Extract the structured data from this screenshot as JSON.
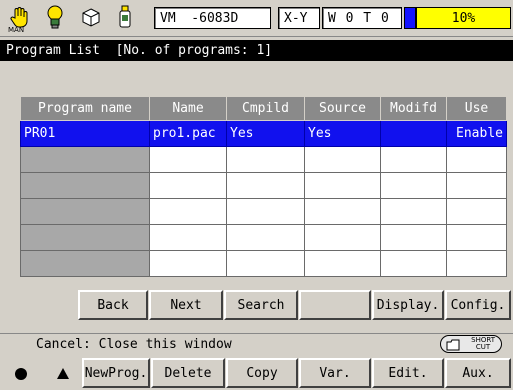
{
  "status": {
    "man_label": "MAN",
    "machine_field": "VM  -6083D",
    "axis_label": "X-Y",
    "coord_value": "W 0 T 0",
    "progress_text": "10%",
    "progress_fill": 0.1,
    "icons": [
      "hand-icon",
      "lightbulb-icon",
      "cube-icon",
      "bottle-icon"
    ],
    "colors": {
      "progress_fill": "#1414ff",
      "progress_bg": "#ffff00"
    }
  },
  "title": "Program List  [No. of programs: 1]",
  "table": {
    "columns": [
      "Program name",
      "Name",
      "Cmpild",
      "Source",
      "Modifd",
      "Use"
    ],
    "rows": [
      [
        "PR01",
        "pro1.pac",
        "Yes",
        "Yes",
        "",
        "Enable"
      ],
      [
        "",
        "",
        "",
        "",
        "",
        ""
      ],
      [
        "",
        "",
        "",
        "",
        "",
        ""
      ],
      [
        "",
        "",
        "",
        "",
        "",
        ""
      ],
      [
        "",
        "",
        "",
        "",
        "",
        ""
      ],
      [
        "",
        "",
        "",
        "",
        "",
        ""
      ]
    ],
    "selected_row": 0
  },
  "toolbar_top": {
    "back": "Back",
    "next": "Next",
    "search": "Search",
    "blank": "",
    "display": "Display.",
    "config": "Config."
  },
  "message": "Cancel: Close this window",
  "shortcut": {
    "line1": "SHORT",
    "line2": "CUT"
  },
  "toolbar_bottom": {
    "newprog": "NewProg.",
    "delete": "Delete",
    "copy": "Copy",
    "var": "Var.",
    "edit": "Edit.",
    "aux": "Aux."
  }
}
